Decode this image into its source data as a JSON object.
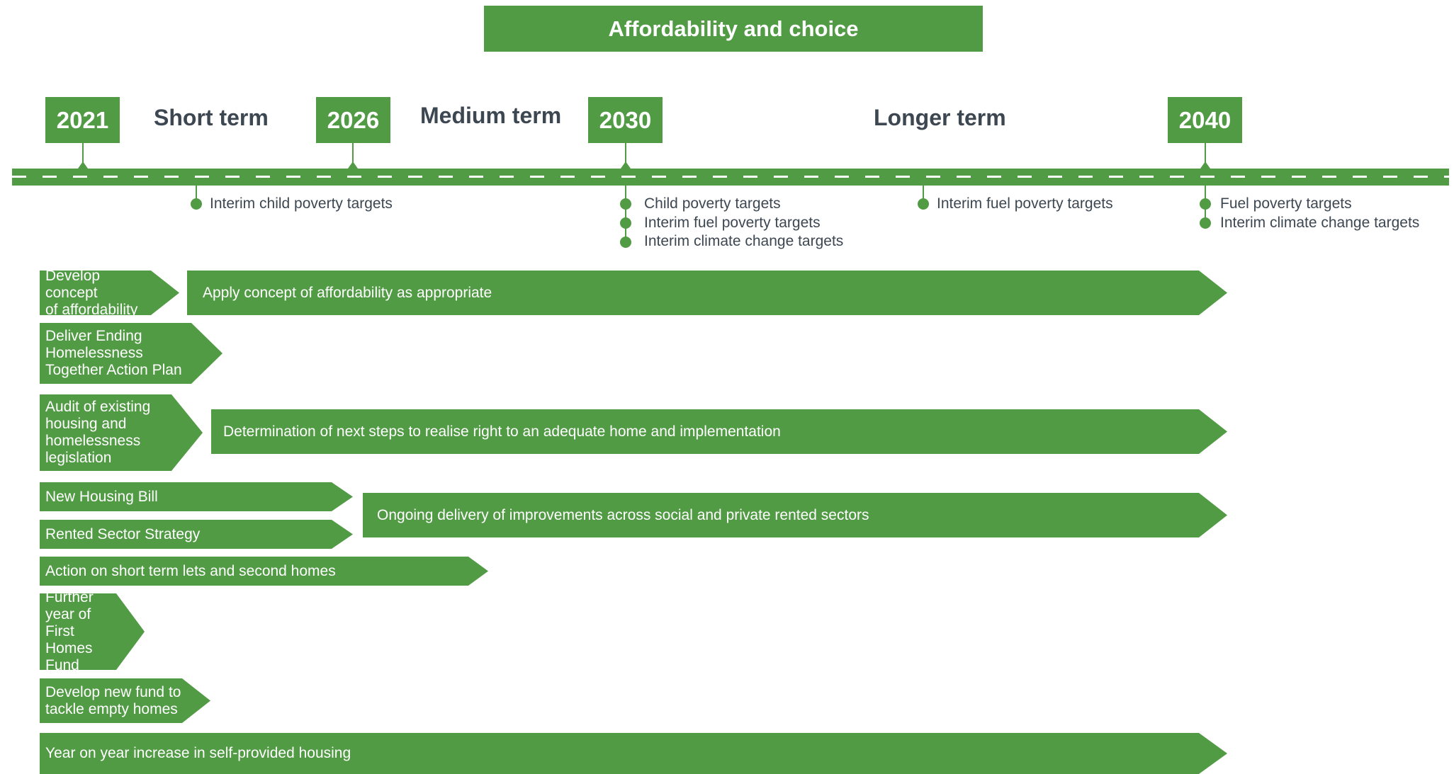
{
  "title": "Affordability and choice",
  "years": [
    "2021",
    "2026",
    "2030",
    "2040"
  ],
  "terms": [
    "Short term",
    "Medium term",
    "Longer term"
  ],
  "milestones": {
    "y2026": [
      "Interim child poverty targets"
    ],
    "y2030": [
      "Child poverty targets",
      "Interim fuel poverty targets",
      "Interim climate change targets"
    ],
    "y2034": [
      "Interim fuel poverty targets"
    ],
    "y2040": [
      "Fuel poverty targets",
      "Interim climate change targets"
    ]
  },
  "actions": [
    "Develop concept\nof affordability",
    "Apply concept of affordability as appropriate",
    "Deliver Ending\nHomelessness\nTogether Action Plan",
    "Audit of existing\nhousing and\nhomelessness\nlegislation",
    "Determination of next steps to realise right to an adequate home and implementation",
    "New Housing Bill",
    "Rented Sector Strategy",
    "Ongoing delivery of improvements across social and private rented sectors",
    "Action on short term lets and second homes",
    "Further\nyear of\nFirst Homes\nFund",
    "Develop new fund to\ntackle empty homes",
    "Year on year increase in self-provided housing"
  ],
  "colors": {
    "green": "#529b45",
    "text_dark": "#3d4752",
    "white": "#ffffff"
  }
}
